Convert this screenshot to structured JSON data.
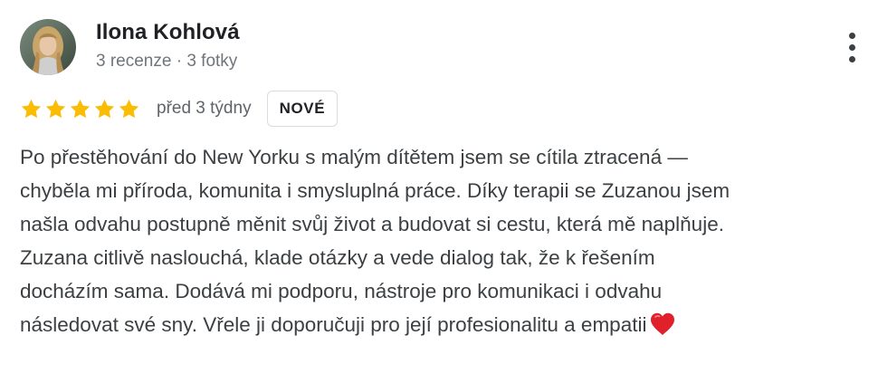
{
  "review": {
    "author": {
      "name": "Ilona Kohlová",
      "meta": "3 recenze · 3 fotky",
      "avatar_icon": "user-photo-avatar"
    },
    "rating": {
      "stars": 5,
      "max_stars": 5,
      "star_color": "#fbbc04"
    },
    "date": "před 3 týdny",
    "badge": "NOVÉ",
    "more_icon": "vertical-dots-icon",
    "text_lines": [
      "Po přestěhování do New Yorku s malým dítětem jsem se cítila ztracená —",
      "chyběla mi příroda, komunita i smysluplná práce. Díky terapii se Zuzanou jsem",
      "našla odvahu postupně měnit svůj život a budovat si cestu, která mě naplňuje.",
      "Zuzana citlivě naslouchá, klade otázky a vede dialog tak, že k řešením",
      "docházím sama. Dodává mi podporu, nástroje pro komunikaci i odvahu",
      "následovat své sny. Vřele ji doporučuji pro její profesionalitu a empatii"
    ],
    "trailing_emoji": "heart-icon",
    "heart_color": "#e0202a"
  }
}
